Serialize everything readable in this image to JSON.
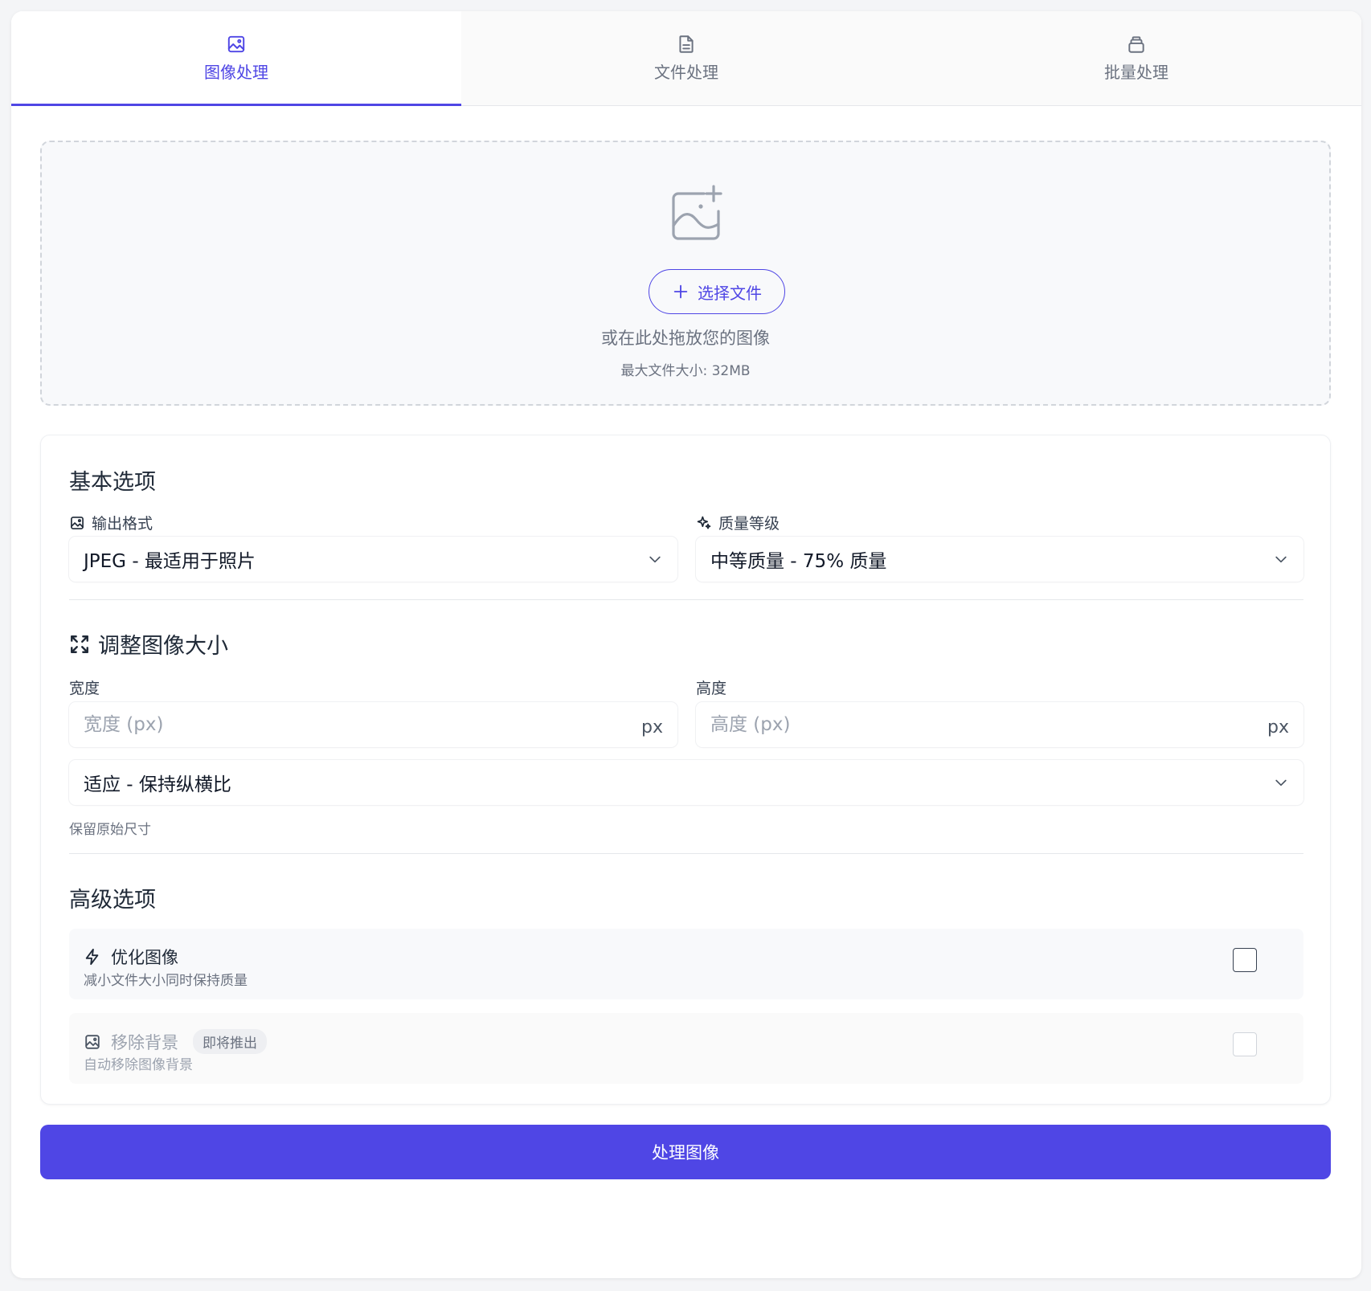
{
  "tabs": [
    {
      "label": "图像处理",
      "icon": "image-icon",
      "active": true
    },
    {
      "label": "文件处理",
      "icon": "file-icon",
      "active": false
    },
    {
      "label": "批量处理",
      "icon": "stack-icon",
      "active": false
    }
  ],
  "dropzone": {
    "icon": "image-add-icon",
    "choose_label": "选择文件",
    "hint": "或在此处拖放您的图像",
    "max_size": "最大文件大小: 32MB"
  },
  "basic": {
    "title": "基本选项",
    "format_label": "输出格式",
    "format_value": "JPEG - 最适用于照片",
    "quality_label": "质量等级",
    "quality_value": "中等质量 - 75% 质量"
  },
  "resize": {
    "title": "调整图像大小",
    "width_label": "宽度",
    "width_placeholder": "宽度 (px)",
    "width_value": "",
    "height_label": "高度",
    "height_placeholder": "高度 (px)",
    "height_value": "",
    "unit": "px",
    "fit_value": "适应 - 保持纵横比",
    "hint": "保留原始尺寸"
  },
  "advanced": {
    "title": "高级选项",
    "options": [
      {
        "title": "优化图像",
        "desc": "减小文件大小同时保持质量",
        "checked": false,
        "disabled": false
      },
      {
        "title": "移除背景",
        "badge": "即将推出",
        "desc": "自动移除图像背景",
        "checked": false,
        "disabled": true
      }
    ]
  },
  "submit_label": "处理图像",
  "colors": {
    "accent": "#4f46e5",
    "background": "#f4f5f7",
    "panel": "#ffffff"
  }
}
